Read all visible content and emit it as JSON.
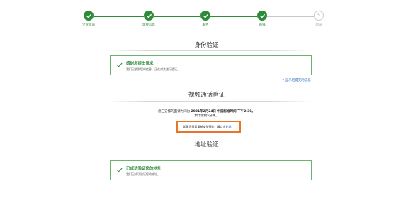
{
  "stepper": {
    "steps": [
      {
        "label": "企业资讯",
        "status": "done"
      },
      {
        "label": "需要信息",
        "status": "done"
      },
      {
        "label": "服务",
        "status": "done"
      },
      {
        "label": "商铺",
        "status": "done"
      },
      {
        "label": "验证",
        "status": "pending",
        "number": "5"
      }
    ],
    "colors": {
      "done": "#2e8b3a",
      "pending": "#c9c9c9"
    }
  },
  "identity": {
    "title": "身份验证",
    "card_title": "感谢您提出请求",
    "card_subtitle": "我们已收到您的信息，正在对其进行验证。"
  },
  "show_more_link": "∨ 显示已提交的信息",
  "video": {
    "title": "视频通话验证",
    "line1_prefix": "您已安排的面试时间为",
    "line1_bold": "2021年2月24日 中国标准时间 下午2:30。",
    "line2": "预计需约5分钟。",
    "notice_text": "如需您需要重新安排预约，请点击",
    "notice_link": "此处",
    "notice_end": "。",
    "notice_border_color": "#e8752a"
  },
  "address": {
    "title": "地址验证",
    "card_title": "已成功验证您的地址",
    "card_subtitle": "我们已成功验证您的地址。"
  }
}
